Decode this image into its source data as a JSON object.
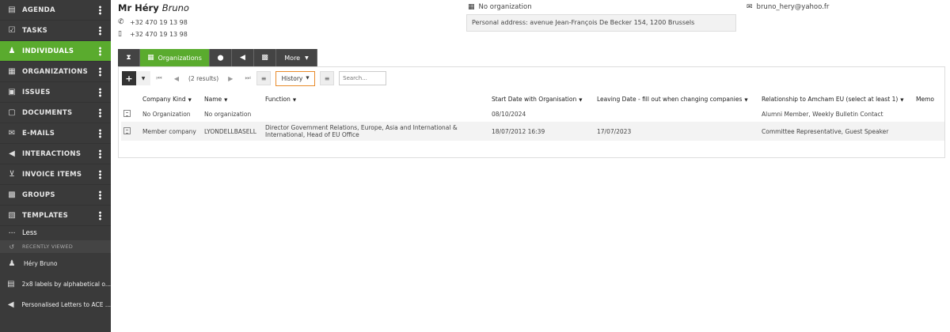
{
  "sidebar": {
    "items": [
      {
        "label": "AGENDA",
        "icon": "calendar-icon",
        "glyph": "▤"
      },
      {
        "label": "TASKS",
        "icon": "checkbox-icon",
        "glyph": "☑"
      },
      {
        "label": "INDIVIDUALS",
        "icon": "person-icon",
        "glyph": "♟"
      },
      {
        "label": "ORGANIZATIONS",
        "icon": "building-icon",
        "glyph": "▦"
      },
      {
        "label": "ISSUES",
        "icon": "briefcase-icon",
        "glyph": "▣"
      },
      {
        "label": "DOCUMENTS",
        "icon": "document-icon",
        "glyph": "▢"
      },
      {
        "label": "E-MAILS",
        "icon": "envelope-icon",
        "glyph": "✉"
      },
      {
        "label": "INTERACTIONS",
        "icon": "megaphone-icon",
        "glyph": "◀"
      },
      {
        "label": "INVOICE ITEMS",
        "icon": "cart-icon",
        "glyph": "⊻"
      },
      {
        "label": "GROUPS",
        "icon": "group-icon",
        "glyph": "▩"
      },
      {
        "label": "TEMPLATES",
        "icon": "template-icon",
        "glyph": "▧"
      }
    ],
    "active_index": 2,
    "less_label": "Less",
    "recently_viewed_label": "RECENTLY VIEWED",
    "recent": [
      {
        "label": "Héry Bruno",
        "icon": "person-icon",
        "glyph": "♟"
      },
      {
        "label": "2x8 labels by alphabetical o...",
        "icon": "template-icon",
        "glyph": "▤"
      },
      {
        "label": "Personalised Letters to ACE ...",
        "icon": "megaphone-icon",
        "glyph": "◀"
      }
    ]
  },
  "header": {
    "title": "Mr Héry",
    "first_name": "Bruno",
    "phone": "+32 470 19 13 98",
    "mobile": "+32 470 19 13 98",
    "organization": "No organization",
    "address": "Personal address: avenue Jean-François De Becker 154, 1200 Brussels",
    "email": "bruno_hery@yahoo.fr"
  },
  "tabs": [
    {
      "name": "tab-history",
      "icon": "hourglass-icon",
      "glyph": "⧗",
      "label": ""
    },
    {
      "name": "tab-organizations",
      "icon": "building-icon",
      "glyph": "▦",
      "label": "Organizations"
    },
    {
      "name": "tab-locations",
      "icon": "map-marker-icon",
      "glyph": "⬤",
      "label": ""
    },
    {
      "name": "tab-interactions",
      "icon": "megaphone-icon",
      "glyph": "◀",
      "label": ""
    },
    {
      "name": "tab-groups",
      "icon": "group-icon",
      "glyph": "▩",
      "label": ""
    },
    {
      "name": "tab-more",
      "icon": "",
      "glyph": "",
      "label": "More"
    }
  ],
  "toolbar": {
    "results": "(2 results)",
    "history_label": "History",
    "search_placeholder": "Search..."
  },
  "table": {
    "columns": [
      "Company Kind",
      "Name",
      "Function",
      "Start Date with Organisation",
      "Leaving Date - fill out when changing companies",
      "Relationship to Amcham EU (select at least 1)",
      "Memo"
    ],
    "rows": [
      [
        "No Organization",
        "No organization",
        "",
        "08/10/2024",
        "",
        "Alumni Member, Weekly Bulletin Contact",
        ""
      ],
      [
        "Member company",
        "LYONDELLBASELL",
        "Director Government Relations, Europe, Asia and International & International, Head of EU Office",
        "18/07/2012 16:39",
        "17/07/2023",
        "Committee Representative, Guest Speaker",
        ""
      ]
    ]
  },
  "colors": {
    "accent": "#5aab2e",
    "sidebar": "#3a3a3a",
    "highlight": "#e88b2b"
  }
}
